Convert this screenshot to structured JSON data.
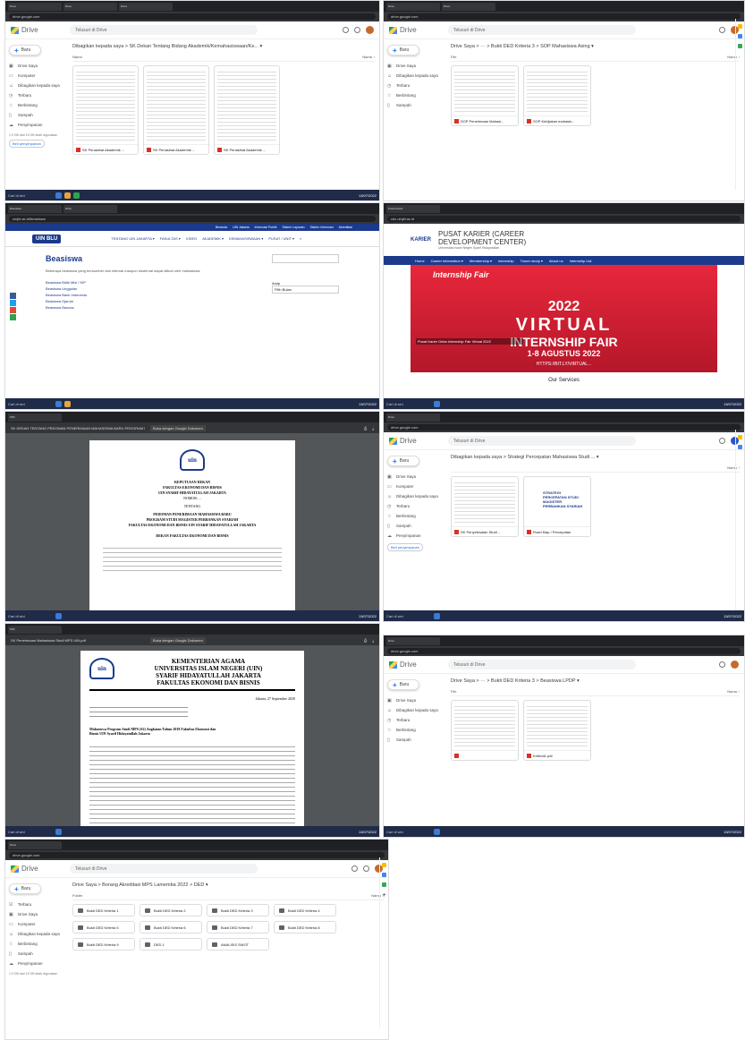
{
  "shots": {
    "drive1": {
      "logo": "Drive",
      "search": "Telusuri di Drive",
      "new": "Baru",
      "side": [
        "Drive Saya",
        "Komputer",
        "Dibagikan kepada saya",
        "Terbaru",
        "Berbintang",
        "Sampah",
        "Penyimpanan"
      ],
      "storage": "1,9 GB dari 15 GB telah digunakan",
      "buy": "Beli penyimpanan",
      "breadcrumb": "Dibagikan kepada saya  >  SK Dekan Tentang Bidang Akademik/Kemahasiswaan/Ke...  ▾",
      "col_name": "Nama",
      "col_sort": "Nama ↑",
      "files": [
        "SK Penasihat Akademik ...",
        "SK Penasihat Akademik ...",
        "SK Penasihat Akademik ..."
      ]
    },
    "drive2": {
      "search": "Telusuri di Drive",
      "breadcrumb": "Drive Saya  >  ···  >  Bukti DED Kriteria 3  >  SOP Mahasiswa Asing  ▾",
      "col_name": "File",
      "col_sort": "Nama ↑",
      "files": [
        "SOP Penerimaan Mahasi...",
        "SOP Kebijakan mahasis..."
      ]
    },
    "web1": {
      "topbar": [
        "Beranda",
        "UIN Jakarta",
        "Informasi Publik",
        "Sistem Layanan",
        "Sistem Informasi",
        "Akreditasi"
      ],
      "nav": [
        "TENTANG UIN JAKARTA ▾",
        "FAKULTAS ▾",
        "VIDEO",
        "AKADEMIK ▾",
        "KEMAHASISWAAN ▾",
        "PUSAT / UNIT ▾"
      ],
      "title": "Beasiswa",
      "intro": "Beberapa beasiswa yang bersumber dari internal maupun eksternal dapat diikuti oleh mahasiswa.",
      "links": [
        "Beasiswa Bidik Misi / KIP",
        "Beasiswa Unggulan",
        "Beasiswa Bank Indonesia",
        "Beasiswa Djarum",
        "Beasiswa Baznas"
      ],
      "search_label": "Arsip",
      "select": "Pilih Bulan"
    },
    "web2": {
      "site_title": "PUSAT KARIER (CAREER DEVELOPMENT CENTER)",
      "subtitle": "Universitas Islam Negeri Syarif Hidayatullah",
      "nav": [
        "Home",
        "Career information ▾",
        "Membership ▾",
        "Internship",
        "Tracer study ▾",
        "About us",
        "Internship List"
      ],
      "banner_top": "Internship Fair",
      "banner_year": "2022",
      "banner_main": "VIRTUAL",
      "banner_sub": "INTERNSHIP FAIR",
      "banner_date": "1-8 AGUSTUS 2022",
      "banner_caption": "Pusat Karier Gelar Internship Fair Virtual 2022",
      "banner_url": "HTTPS://BIT.LY/VIRTUAL...",
      "services": "Our Services"
    },
    "pdf1": {
      "file": "SK DEKAN TENTANG PEDOMAN PENERIMAAN MAHASISWA BARU PROGRAM MAGISTER.pdf",
      "open_with": "Buka dengan Google Dokumen",
      "line1": "KEPUTUSAN DEKAN",
      "line2": "FAKULTAS EKONOMI DAN BISNIS",
      "line3": "UIN SYARIF HIDAYATULLAH JAKARTA",
      "line4": "NOMOR: ...",
      "line5": "TENTANG",
      "line6": "PEDOMAN PENERIMAAN MAHASISWA BARU",
      "line7": "PROGRAM STUDI MAGISTER PERBANKAN SYARIAH",
      "line8": "FAKULTAS EKONOMI DAN BISNIS UIN SYARIF HIDAYATULLAH JAKARTA",
      "line9": "DEKAN FAKULTAS EKONOMI DAN BISNIS"
    },
    "drive3": {
      "search": "Telusuri di Drive",
      "breadcrumb": "Dibagikan kepada saya  >  Strategi Percepatan Mahasiswa Studi ...  ▾",
      "col_sort": "Nama ↑",
      "files": [
        "SK Penyelesaian Studi ...",
        "Road Map / Percepatan"
      ],
      "thumb_text": "STRATEGI PERCEPATAN STUDI MAGISTER PERBANKAN SYARIAH",
      "buy": "Beli penyimpanan"
    },
    "pdf2": {
      "file": "SK Penerimaan Mahasiswa Studi MPS UIN.pdf",
      "open_with": "Buka dengan Google Dokumen",
      "h1": "KEMENTERIAN AGAMA",
      "h2": "UNIVERSITAS ISLAM NEGERI (UIN)",
      "h3": "SYARIF HIDAYATULLAH JAKARTA",
      "h4": "FAKULTAS EKONOMI DAN BISNIS",
      "date": "Jakarta, 27 September 2020",
      "body": "Mahasiswa Program Studi MPS (S2) Angkatan Tahun 2018 Fakultas Ekonomi dan Bisnis UIN Syarif Hidayatullah Jakarta"
    },
    "drive4": {
      "search": "Telusuri di Drive",
      "breadcrumb": "Drive Saya  >  ···  >  Bukti DED Kriteria 3  >  Beasiswa LPDP  ▾",
      "col_name": "File",
      "files": [
        "",
        "Kriteria1.pdf"
      ]
    },
    "drive5": {
      "search": "Telusuri di Drive",
      "breadcrumb": "Drive Saya  >  Borang Akreditasi MPS Lamemba 2022  >  DED  ▾",
      "col_name": "Folder",
      "col_sort": "Nama ↑",
      "folders": [
        "Bukti DED Kriteria 1",
        "Bukti DED Kriteria 2",
        "Bukti DED Kriteria 3",
        "Bukti DED Kriteria 4",
        "Bukti DED Kriteria 5",
        "Bukti DED Kriteria 6",
        "Bukti DED Kriteria 7",
        "Bukti DED Kriteria 8",
        "Bukti DED Kriteria 9",
        "DED 1",
        "ANALISIS SWOT"
      ]
    }
  },
  "taskbar_search": "Cari di sini",
  "time": "13/07/2022"
}
